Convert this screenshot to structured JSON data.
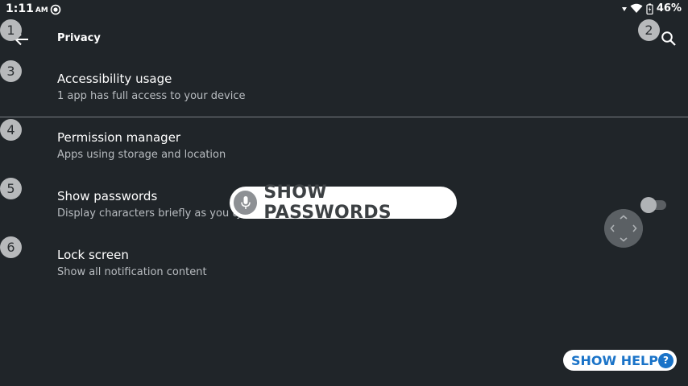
{
  "status": {
    "time": "1:11",
    "ampm": "AM",
    "battery": "46%"
  },
  "appbar": {
    "title": "Privacy"
  },
  "rows": [
    {
      "title": "Accessibility usage",
      "subtitle": "1 app has full access to your device"
    },
    {
      "title": "Permission manager",
      "subtitle": "Apps using storage and location"
    },
    {
      "title": "Show passwords",
      "subtitle": "Display characters briefly as you typ"
    },
    {
      "title": "Lock screen",
      "subtitle": "Show all notification content"
    }
  ],
  "badges": [
    "1",
    "2",
    "3",
    "4",
    "5",
    "6"
  ],
  "toggle": {
    "on": false
  },
  "voice": {
    "text": "SHOW PASSWORDS"
  },
  "help": {
    "label": "SHOW HELP",
    "q": "?"
  },
  "icons": {
    "back": "arrow-back-icon",
    "search": "search-icon",
    "mic": "mic-icon",
    "wifi": "wifi-icon",
    "battery": "battery-icon"
  },
  "colors": {
    "background": "#202529",
    "help_blue": "#1a73c8"
  }
}
